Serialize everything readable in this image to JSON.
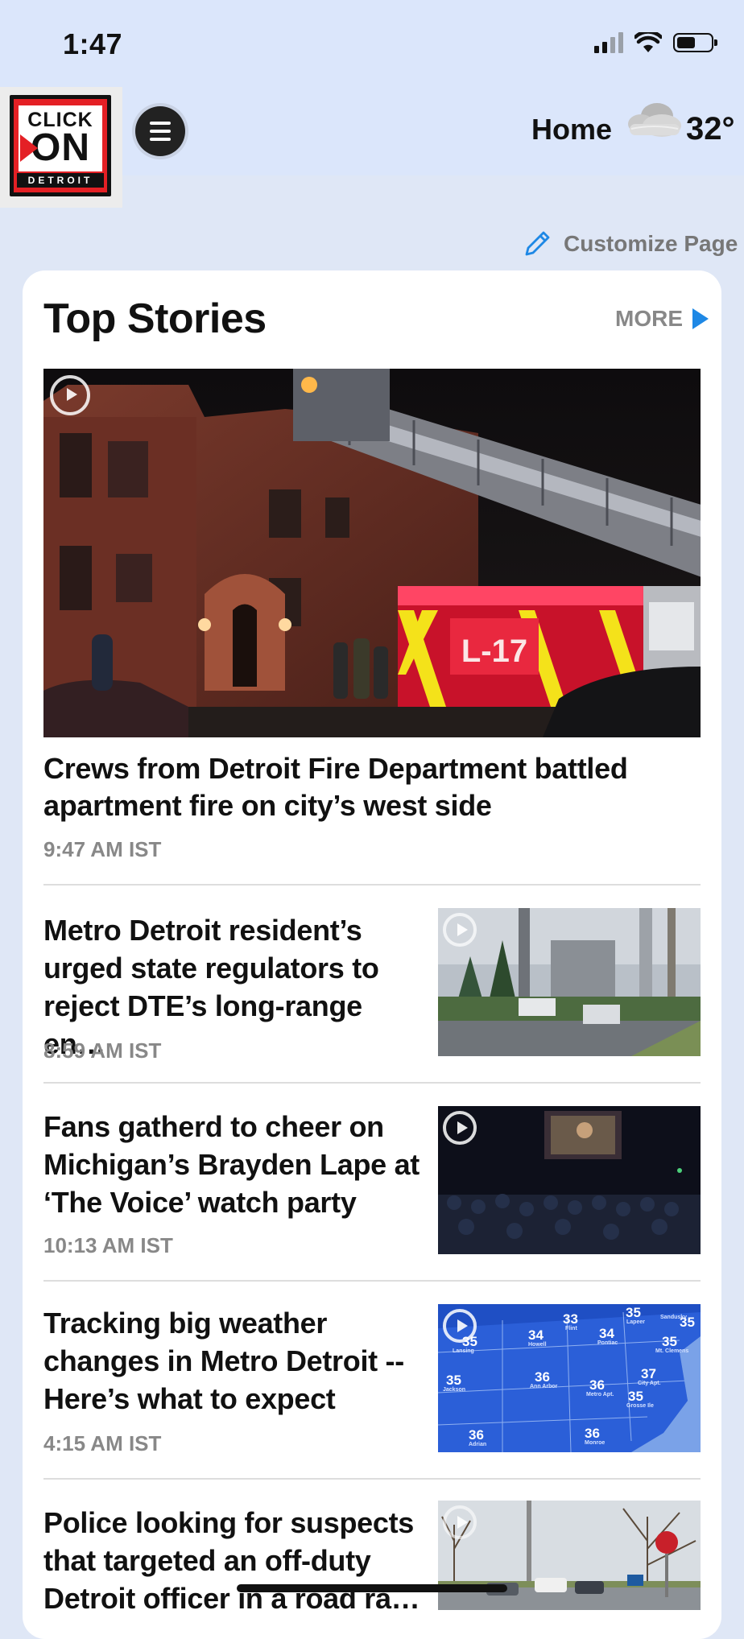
{
  "status_bar": {
    "time": "1:47"
  },
  "header": {
    "logo": {
      "line1": "CLICK",
      "line2": "ON",
      "line3": "DETROIT"
    },
    "nav_label": "Home",
    "temperature": "32°",
    "weather_icon": "cloud-icon"
  },
  "customize": {
    "label": "Customize Page",
    "icon": "pencil-icon"
  },
  "section": {
    "title": "Top Stories",
    "more_label": "MORE"
  },
  "hero": {
    "headline": "Crews from Detroit Fire Department battled apartment fire on city’s west side",
    "time": "9:47 AM IST",
    "truck_label": "L-17"
  },
  "stories": [
    {
      "title": "Metro Detroit resident’s urged state regulators to reject DTE’s long-range en…",
      "time": "8:59 AM IST"
    },
    {
      "title": "Fans gatherd to cheer on Michigan’s Brayden Lape at ‘The Voice’ watch party",
      "time": "10:13 AM IST"
    },
    {
      "title": "Tracking big weather changes in Metro Detroit -- Here’s what to expect",
      "time": "4:15 AM IST"
    },
    {
      "title": "Police looking for suspects that targeted an off-duty Detroit officer in a road ra…",
      "time": ""
    }
  ],
  "weather_map": {
    "temps": [
      "35",
      "33",
      "35",
      "34",
      "34",
      "35",
      "35",
      "37",
      "35",
      "36",
      "36",
      "35",
      "36",
      "36"
    ],
    "places": [
      "Lansing",
      "Flint",
      "Lapeer",
      "Sandusky",
      "Howell",
      "Pontiac",
      "Mt. Clemens",
      "Jackson",
      "Ann Arbor",
      "Metro Apt.",
      "City Apt.",
      "Grosse Ile",
      "Adrian",
      "Monroe"
    ]
  },
  "colors": {
    "accent": "#1e88e5",
    "logo_red": "#e42025",
    "header_bg": "#dbe6fb"
  }
}
